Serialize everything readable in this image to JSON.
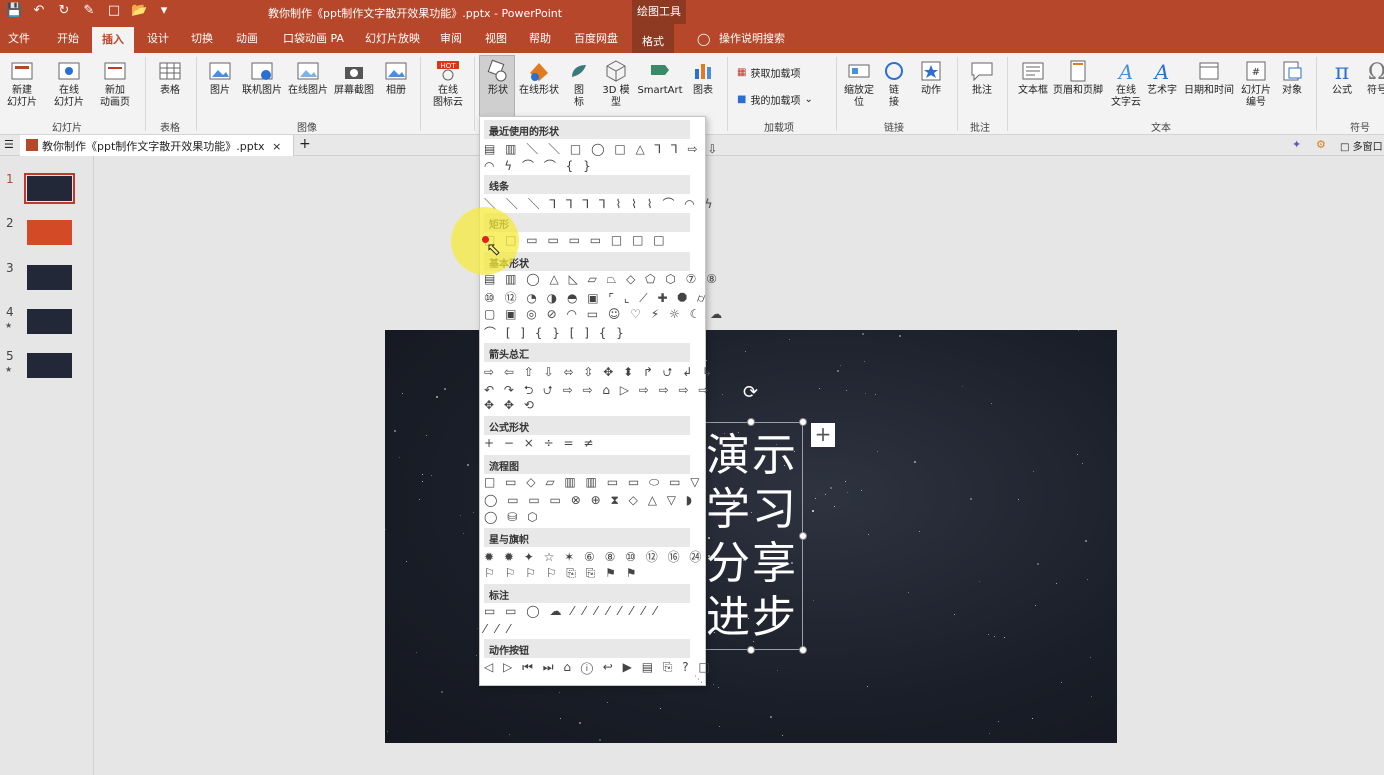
{
  "window": {
    "title": "教你制作《ppt制作文字散开效果功能》.pptx  -  PowerPoint",
    "tools_title": "绘图工具"
  },
  "qat": [
    "save-icon",
    "undo-icon",
    "redo-icon",
    "format-painter-icon",
    "new-file-icon",
    "open-icon",
    "customize-icon"
  ],
  "tabs": [
    "文件",
    "开始",
    "插入",
    "设计",
    "切换",
    "动画",
    "口袋动画 PA",
    "幻灯片放映",
    "审阅",
    "视图",
    "帮助",
    "百度网盘",
    "格式"
  ],
  "active_tab": "插入",
  "search_tell": "操作说明搜索",
  "ribbon": {
    "slides": {
      "new_slide": "新建\n幻灯片",
      "online_slide": "在线\n幻灯片",
      "new_anim_page": "新加\n动画页",
      "label": "幻灯片"
    },
    "tables": {
      "table": "表格",
      "label": "表格"
    },
    "images": {
      "picture": "图片",
      "online_picture": "联机图片",
      "online_pic2": "在线图片",
      "screenshot": "屏幕截图",
      "album": "相册",
      "label": "图像"
    },
    "online_icons": {
      "label": "在线\n图标云",
      "badge": "HOT"
    },
    "illustrations": {
      "shapes": "形状",
      "online_shapes": "在线形状",
      "icons": "图\n标",
      "model3d": "3D 模\n型",
      "smartart": "SmartArt",
      "chart": "图表"
    },
    "addins": {
      "get": "获取加载项",
      "mine": "我的加载项",
      "label": "加载项"
    },
    "links": {
      "zoom": "缩放定\n位",
      "link": "链\n接",
      "action": "动作",
      "label": "链接"
    },
    "comments": {
      "comment": "批注",
      "label": "批注"
    },
    "text": {
      "textbox": "文本框",
      "header_footer": "页眉和页脚",
      "wordart_online": "在线\n文字云",
      "wordart": "艺术字",
      "datetime": "日期和时间",
      "slide_number": "幻灯片\n编号",
      "object": "对象",
      "label": "文本"
    },
    "symbols": {
      "equation": "公式",
      "symbol": "符号",
      "label": "符号"
    }
  },
  "doc_tab": {
    "name": "教你制作《ppt制作文字散开效果功能》.pptx",
    "close": "×",
    "more": "⋮",
    "add": "+"
  },
  "window_btn": "多窗口",
  "thumbnails": [
    {
      "num": "1",
      "star": ""
    },
    {
      "num": "2",
      "star": ""
    },
    {
      "num": "3",
      "star": ""
    },
    {
      "num": "4",
      "star": "★"
    },
    {
      "num": "5",
      "star": "★"
    }
  ],
  "slide": {
    "lines": [
      "演示",
      "学习",
      "分享",
      "进步"
    ]
  },
  "shapes_menu": {
    "sections": [
      {
        "title": "最近使用的形状",
        "rows": [
          "▤ ▥ ＼ ＼ □ ◯ □ △ ⅂ ⅂ ⇨ ⇩",
          "◠ ϟ ⌒ ⌒ { }"
        ]
      },
      {
        "title": "线条",
        "rows": [
          "＼ ＼ ＼ ⅂ ⅂ ⅂ ⅂ ⌇ ⌇ ⌇ ⌒ ◠ ϟ"
        ]
      },
      {
        "title": "矩形",
        "rows": [
          "□ □ ▭ ▭ ▭ ▭ □ □ □"
        ]
      },
      {
        "title": "基本形状",
        "rows": [
          "▤ ▥ ◯ △ ◺ ▱ ⏢ ◇ ⬠ ⬡ ⑦ ⑧",
          "⑩ ⑫ ◔ ◑ ◓ ▣ ⌜ ⌞ ⟋ ✚ ⯃ ⌭",
          "▢ ▣ ◎ ⊘ ◠ ▭ ☺ ♡ ⚡ ☼ ☾ ☁",
          "⌒ [ ] { } [ ] { }"
        ]
      },
      {
        "title": "箭头总汇",
        "rows": [
          "⇨ ⇦ ⇧ ⇩ ⬄ ⇳ ✥ ⬍ ↱ ⮍ ↲ ↳",
          "↶ ↷ ⮌ ⮍ ⇨ ⇨ ⌂ ▷ ⇨ ⇨ ⇨ ⇨",
          "✥ ✥ ⟲"
        ]
      },
      {
        "title": "公式形状",
        "rows": [
          "+ − × ÷ = ≠"
        ]
      },
      {
        "title": "流程图",
        "rows": [
          "□ ▭ ◇ ▱ ▥ ▥ ▭ ▭ ⬭ ▭ ▽",
          "◯ ▭ ▭ ▭ ⊗ ⊕ ⧗ ◇ △ ▽ ◗",
          "◯ ⛁ ⬡"
        ]
      },
      {
        "title": "星与旗帜",
        "rows": [
          "✹ ✹ ✦ ☆ ✶ ⑥ ⑧ ⑩ ⑫ ⑯ ㉔",
          "⚐ ⚐ ⚐ ⚐ ⎘ ⎘ ⚑ ⚑"
        ]
      },
      {
        "title": "标注",
        "rows": [
          "▭ ▭ ◯ ☁ ⁄ ⁄ ⁄ ⁄ ⁄ ⁄ ⁄ ⁄",
          "⁄ ⁄ ⁄"
        ]
      },
      {
        "title": "动作按钮",
        "rows": [
          "◁ ▷ ⏮ ⏭ ⌂ ⓘ ↩ ▶ ▤ ⎘ ? □"
        ]
      }
    ]
  }
}
